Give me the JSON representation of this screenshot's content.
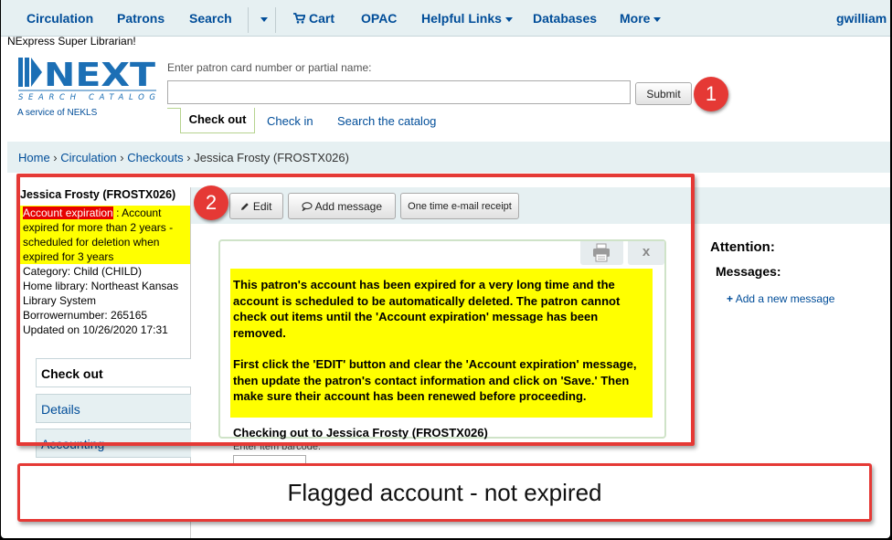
{
  "nav": {
    "circulation": "Circulation",
    "patrons": "Patrons",
    "search": "Search",
    "cart": "Cart",
    "opac": "OPAC",
    "helpful_links": "Helpful Links",
    "databases": "Databases",
    "more": "More",
    "user": "gwilliam"
  },
  "branch": "NExpress Super Librarian!",
  "logo": {
    "word": "NEXT",
    "sub": "SEARCH CATALOG",
    "tagline": "A service of NEKLS"
  },
  "search": {
    "label": "Enter patron card number or partial name:",
    "value": "",
    "submit": "Submit",
    "tabs": [
      "Check out",
      "Check in",
      "Search the catalog"
    ]
  },
  "breadcrumb": {
    "home": "Home",
    "circulation": "Circulation",
    "checkouts": "Checkouts",
    "current": "Jessica Frosty (FROSTX026)"
  },
  "patron": {
    "name": "Jessica Frosty (FROSTX026)",
    "expiration_label": "Account expiration",
    "expiration_text": " : Account expired for more than 2 years - scheduled for deletion when expired for 3 years",
    "category": "Category: Child (CHILD)",
    "home_library": "Home library: Northeast Kansas Library System",
    "borrowernumber": "Borrowernumber: 265165",
    "updated": "Updated on 10/26/2020 17:31"
  },
  "sidebar_tabs": [
    "Check out",
    "Details",
    "Accounting"
  ],
  "toolbar": {
    "edit": "Edit",
    "add_message": "Add message",
    "receipt": "One time e-mail receipt"
  },
  "alert": {
    "close": "x",
    "p1": "This patron's account has been expired for a very long time and the account is scheduled to be automatically deleted. The patron cannot check out items until the 'Account expiration' message has been removed.",
    "p2": "First click the 'EDIT' button and clear the 'Account expiration' message, then update the patron's contact information and click on 'Save.' Then make sure their account has been renewed before proceeding."
  },
  "checkout": {
    "heading": "Checking out to Jessica Frosty (FROSTX026)",
    "barcode_label": "Enter item barcode:"
  },
  "attention": {
    "title": "Attention:",
    "messages": "Messages:",
    "add_link": "Add a new message"
  },
  "annotations": {
    "one": "1",
    "two": "2",
    "caption": "Flagged account - not expired"
  },
  "colors": {
    "link": "#004d99",
    "highlight": "#ffff00",
    "expiration_red": "#e60000",
    "annotation_red": "#e53935",
    "band": "#e6f0f2"
  }
}
